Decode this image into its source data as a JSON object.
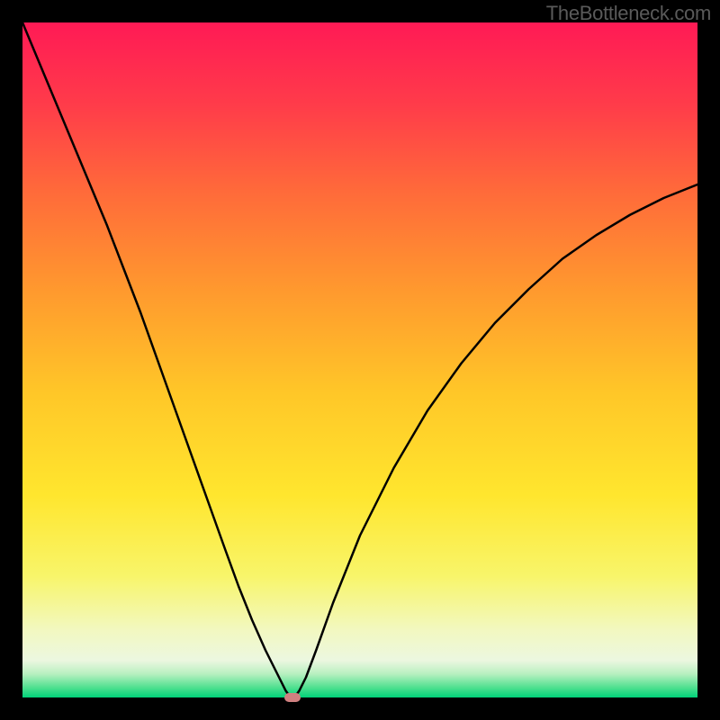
{
  "watermark": "TheBottleneck.com",
  "chart_data": {
    "type": "line",
    "title": "",
    "xlabel": "",
    "ylabel": "",
    "xlim": [
      0,
      100
    ],
    "ylim": [
      0,
      100
    ],
    "axes_visible": false,
    "background_gradient": {
      "stops": [
        {
          "pos": 0.0,
          "color": "#ff1a55"
        },
        {
          "pos": 0.12,
          "color": "#ff3b4a"
        },
        {
          "pos": 0.25,
          "color": "#ff6a3a"
        },
        {
          "pos": 0.4,
          "color": "#ff9a2e"
        },
        {
          "pos": 0.55,
          "color": "#ffc728"
        },
        {
          "pos": 0.7,
          "color": "#ffe62e"
        },
        {
          "pos": 0.82,
          "color": "#f8f56a"
        },
        {
          "pos": 0.9,
          "color": "#f2f8c0"
        },
        {
          "pos": 0.945,
          "color": "#ecf7e0"
        },
        {
          "pos": 0.965,
          "color": "#b8f0c0"
        },
        {
          "pos": 0.985,
          "color": "#50e090"
        },
        {
          "pos": 1.0,
          "color": "#00d279"
        }
      ]
    },
    "series": [
      {
        "name": "bottleneck-curve",
        "color": "#000000",
        "stroke_width": 2.5,
        "x": [
          0.0,
          2.5,
          5.0,
          7.5,
          10.0,
          12.5,
          15.0,
          17.5,
          20.0,
          22.5,
          25.0,
          27.5,
          30.0,
          32.0,
          34.0,
          36.0,
          37.5,
          38.5,
          39.0,
          39.5,
          40.0,
          40.5,
          41.0,
          42.0,
          43.5,
          46.0,
          50.0,
          55.0,
          60.0,
          65.0,
          70.0,
          75.0,
          80.0,
          85.0,
          90.0,
          95.0,
          100.0
        ],
        "y": [
          100.0,
          94.0,
          88.0,
          82.0,
          76.0,
          70.0,
          63.5,
          57.0,
          50.0,
          43.0,
          36.0,
          29.0,
          22.0,
          16.5,
          11.5,
          7.0,
          4.0,
          2.0,
          1.0,
          0.3,
          0.0,
          0.3,
          1.0,
          3.0,
          7.0,
          14.0,
          24.0,
          34.0,
          42.5,
          49.5,
          55.5,
          60.5,
          65.0,
          68.5,
          71.5,
          74.0,
          76.0
        ]
      }
    ],
    "marker": {
      "x": 40.0,
      "y": 0.0,
      "color": "#d08080"
    }
  }
}
